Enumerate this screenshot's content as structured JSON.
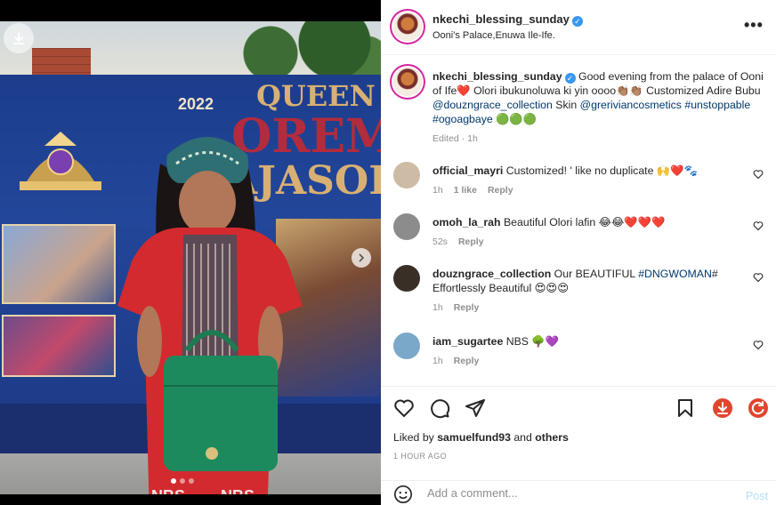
{
  "post": {
    "username": "nkechi_blessing_sunday",
    "location": "Ooni's Palace,Enuwa Ile-Ife.",
    "banner": {
      "year": "2022",
      "line1": "QUEEN",
      "line2": "OREMI",
      "line3": "AJASORO"
    },
    "caption": {
      "username": "nkechi_blessing_sunday",
      "text_a": "Good evening from the palace of Ooni of Ife",
      "emoji_a": "❤️",
      "text_b": " Olori ibukunoluwa ki yin oooo",
      "emoji_b": "👏🏽👏🏽",
      "text_c": " Customized Adire Bubu ",
      "tag1": "@douzngrace_collection",
      "text_d": " Skin ",
      "tag2": "@grerivian​cosmetics",
      "tag3": "#unstoppable",
      "tag4": "#ogoagbaye",
      "emoji_c": "🟢🟢🟢",
      "edited": "Edited · 1h"
    },
    "comments": [
      {
        "username": "official_mayri",
        "text": "Customized! ' like no duplicate 🙌❤️🐾",
        "time": "1h",
        "likes": "1 like",
        "reply": "Reply",
        "avatar": "#cdbba5"
      },
      {
        "username": "omoh_la_rah",
        "text": "Beautiful Olori lafin 😂😂❤️❤️❤️",
        "time": "52s",
        "likes": "",
        "reply": "Reply",
        "avatar": "#8c8c8c"
      },
      {
        "username": "douzngrace_collection",
        "text_a": "Our BEAUTIFUL ",
        "tag": "#DNGWOMAN",
        "text_b": "# Effortlessly Beautiful 😍😍😍",
        "time": "1h",
        "likes": "",
        "reply": "Reply",
        "avatar": "#3a2f27"
      },
      {
        "username": "iam_sugartee",
        "text": "NBS 🌳💜",
        "time": "1h",
        "likes": "",
        "reply": "Reply",
        "avatar": "#7aa8c9"
      }
    ],
    "liked_by": {
      "prefix": "Liked by ",
      "user": "samuelfund93",
      "mid": " and ",
      "others": "others"
    },
    "time_ago": "1 HOUR AGO",
    "add_comment_placeholder": "Add a comment...",
    "post_label": "Post",
    "more_label": "•••",
    "colors": {
      "verified": "#3897f0",
      "link": "#00376b",
      "muted": "#8e8e8e",
      "download_red": "#e0452f"
    },
    "icons": [
      "heart-icon",
      "comment-icon",
      "share-icon",
      "bookmark-icon",
      "download-icon",
      "refresh-icon",
      "emoji-icon",
      "download-arrow-icon",
      "chevron-right-icon"
    ]
  }
}
